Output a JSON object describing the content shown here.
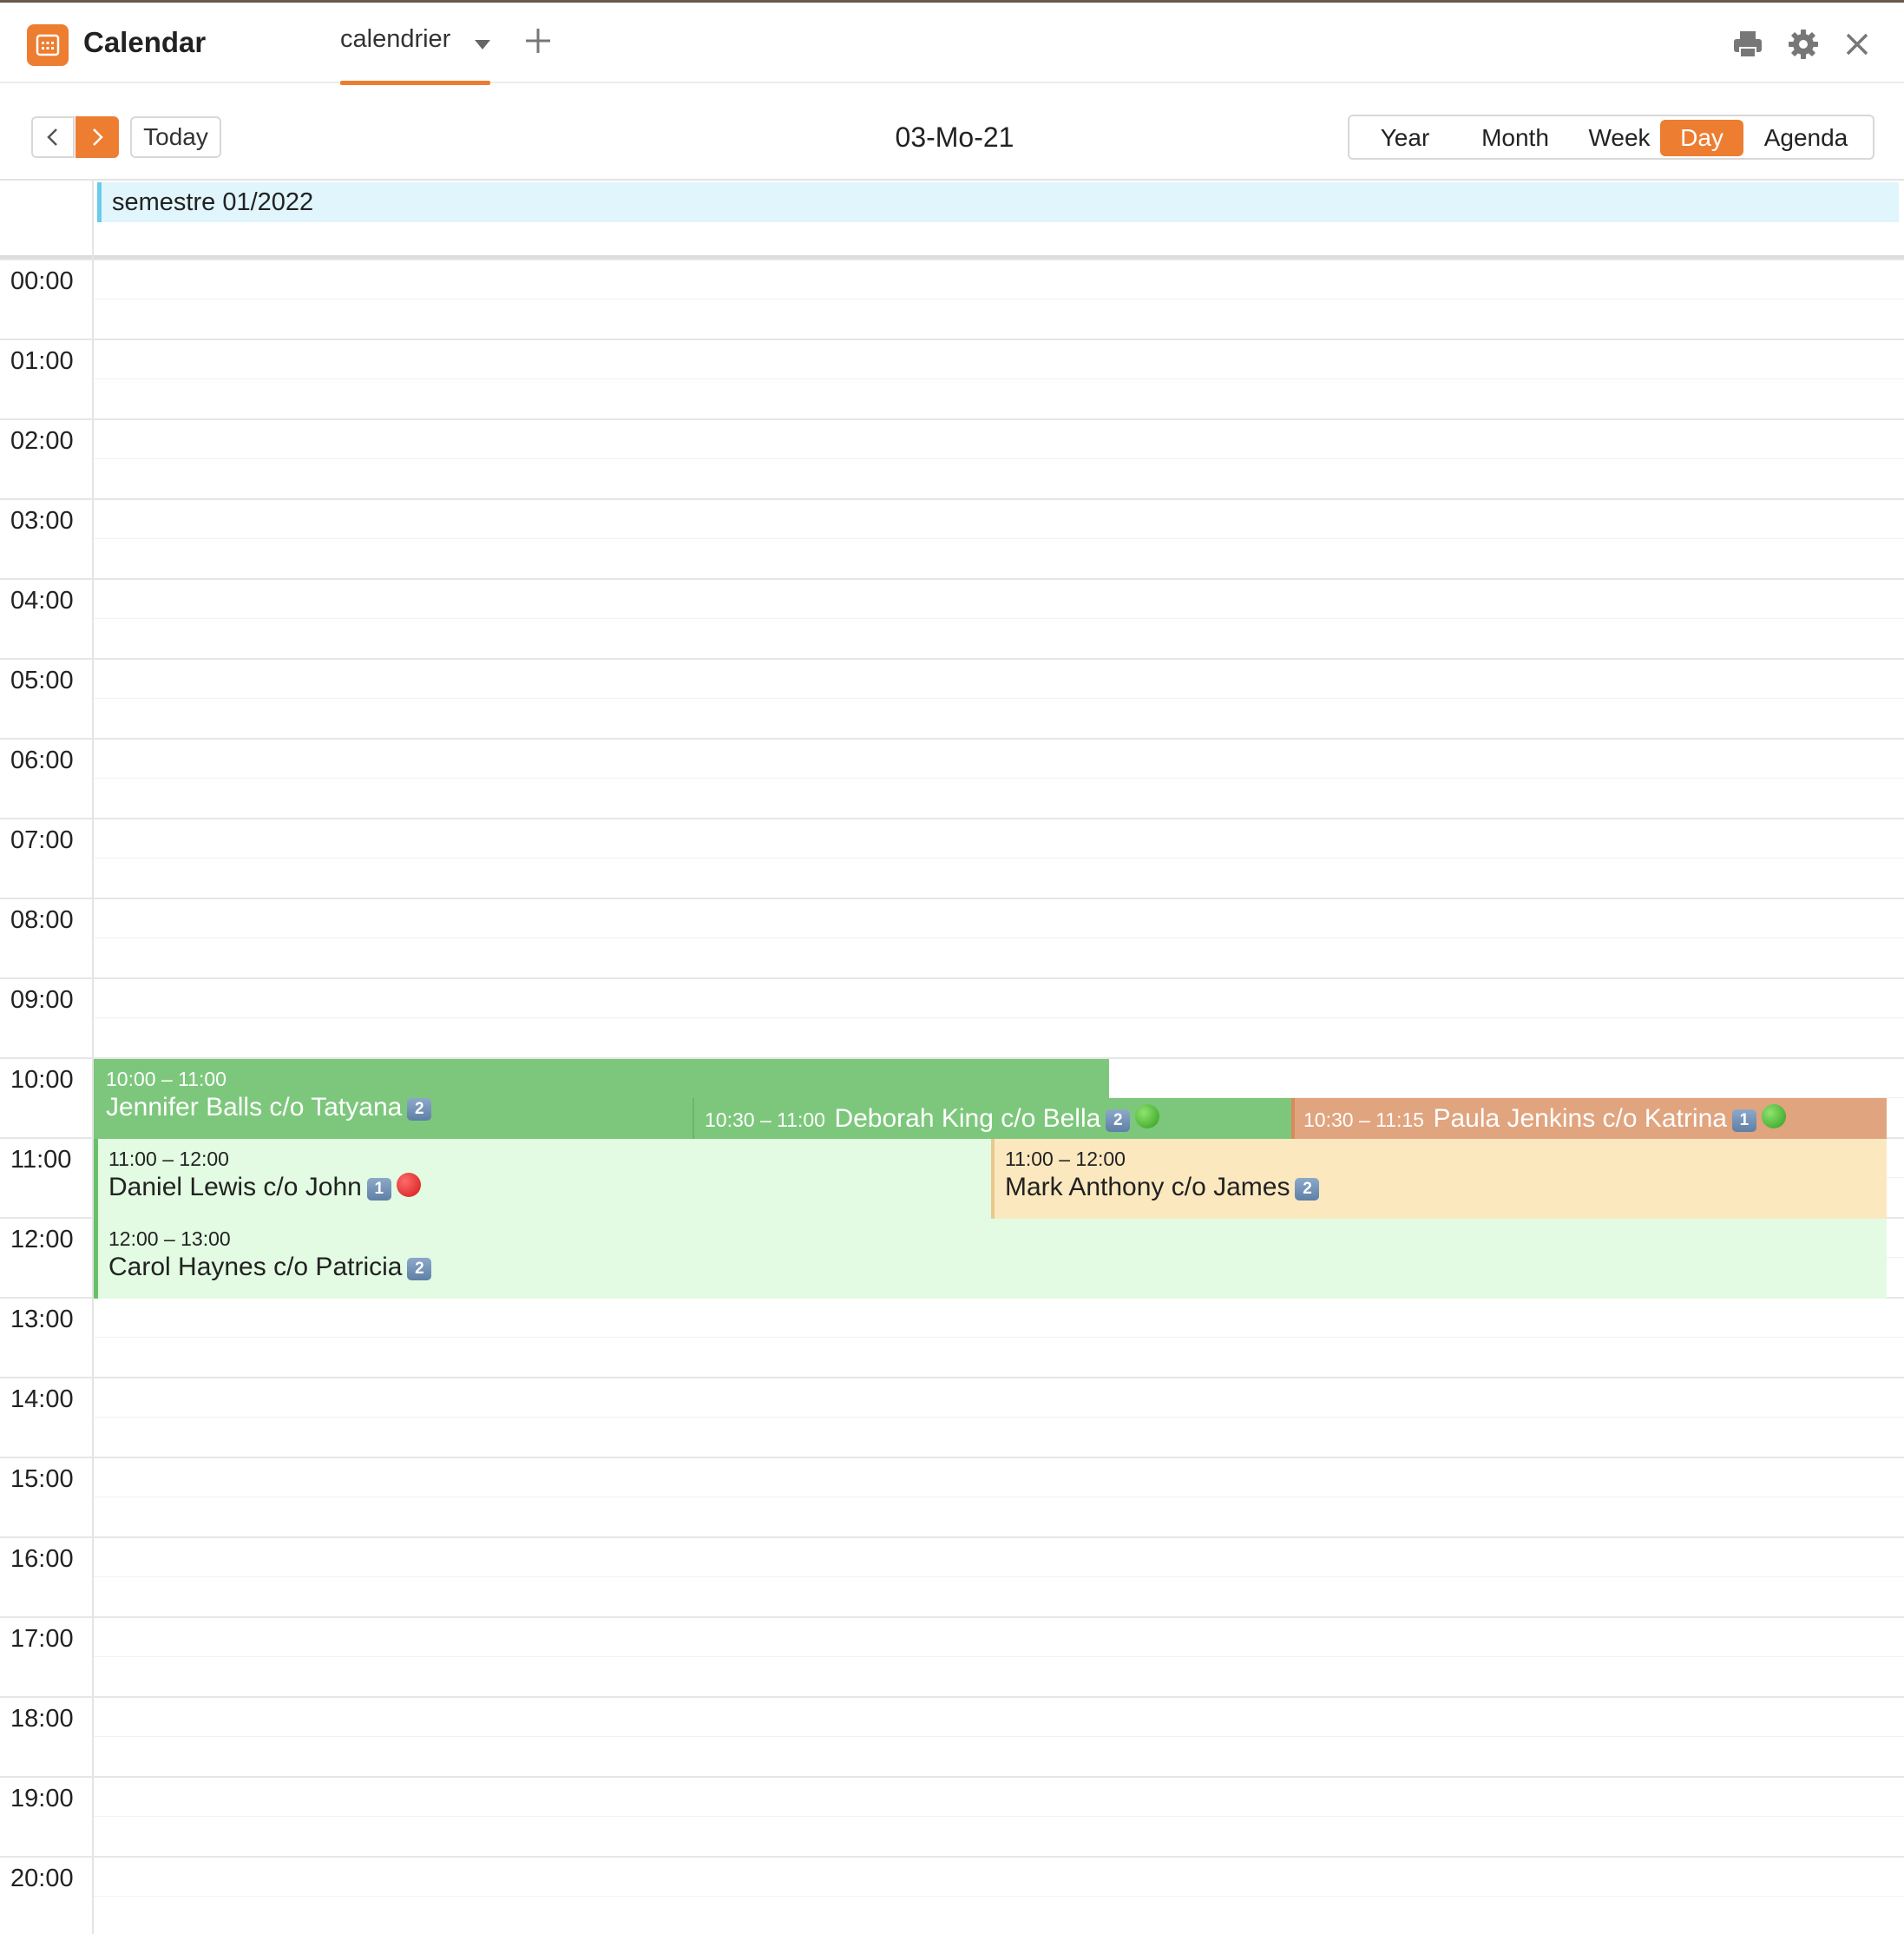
{
  "app": {
    "title": "Calendar"
  },
  "tabs": [
    {
      "label": "calendrier"
    }
  ],
  "toolbar": {
    "today_label": "Today",
    "date_title": "03-Mo-21",
    "views": [
      {
        "label": "Year",
        "active": false
      },
      {
        "label": "Month",
        "active": false
      },
      {
        "label": "Week",
        "active": false
      },
      {
        "label": "Day",
        "active": true
      },
      {
        "label": "Agenda",
        "active": false
      }
    ]
  },
  "allday_event": {
    "title": "semestre 01/2022"
  },
  "hours": [
    "00:00",
    "01:00",
    "02:00",
    "03:00",
    "04:00",
    "05:00",
    "06:00",
    "07:00",
    "08:00",
    "09:00",
    "10:00",
    "11:00",
    "12:00",
    "13:00",
    "14:00",
    "15:00",
    "16:00",
    "17:00",
    "18:00",
    "19:00",
    "20:00"
  ],
  "events": {
    "jennifer": {
      "time": "10:00 – 11:00",
      "title": "Jennifer Balls c/o Tatyana",
      "badge": "2"
    },
    "deborah": {
      "time": "10:30 – 11:00",
      "title": "Deborah King c/o Bella",
      "badge": "2",
      "status": "green"
    },
    "paula": {
      "time": "10:30 – 11:15",
      "title": "Paula Jenkins c/o Katrina",
      "badge": "1",
      "status": "green"
    },
    "daniel": {
      "time": "11:00 – 12:00",
      "title": "Daniel Lewis c/o John",
      "badge": "1",
      "status": "red"
    },
    "mark": {
      "time": "11:00 – 12:00",
      "title": "Mark Anthony c/o James",
      "badge": "2"
    },
    "carol": {
      "time": "12:00 – 13:00",
      "title": "Carol Haynes c/o Patricia",
      "badge": "2"
    }
  },
  "colors": {
    "accent": "#ed7d31",
    "event_green": "#7dc77d",
    "event_light_green": "#e2fbe2",
    "event_yellow": "#fbe8bf",
    "event_orange": "#e0a47f",
    "allday_blue": "#e0f6fc"
  },
  "icons": [
    "calendar-app-icon",
    "caret-down-icon",
    "plus-icon",
    "print-icon",
    "gear-icon",
    "close-icon",
    "chevron-left-icon",
    "chevron-right-icon"
  ]
}
